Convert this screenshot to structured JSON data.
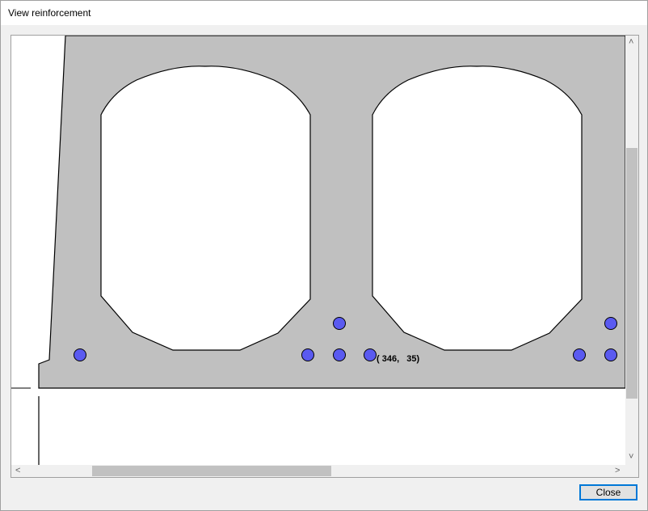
{
  "window": {
    "title": "View reinforcement"
  },
  "drawing": {
    "section_fill": "#c0c0c0",
    "rebar_color": "#5a5af0",
    "coordinate_readout": "( 346,   35)"
  },
  "buttons": {
    "close_label": "Close"
  },
  "scrollbars": {
    "up_arrow": "˄",
    "down_arrow": "˅",
    "left_arrow": "<",
    "right_arrow": ">"
  }
}
